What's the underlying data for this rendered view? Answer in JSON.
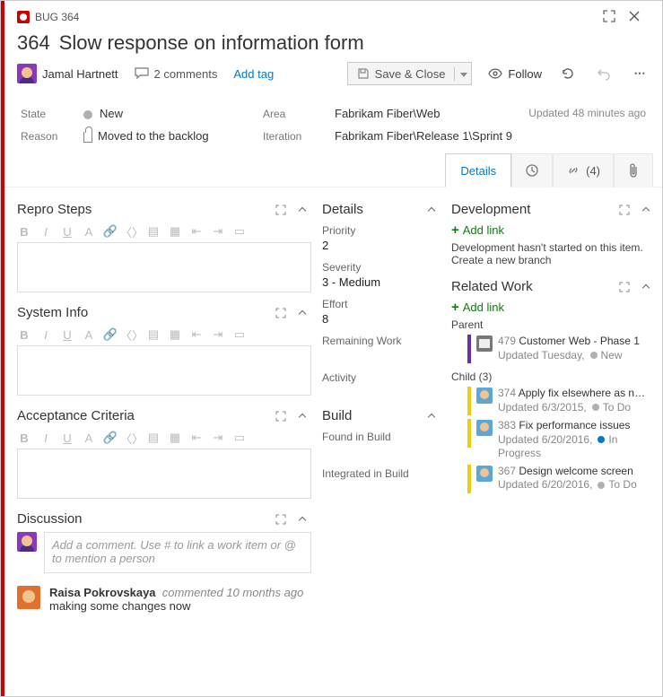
{
  "header": {
    "type_label": "BUG 364",
    "id": "364",
    "title": "Slow response on information form",
    "assignee": "Jamal Hartnett",
    "comments_count": "2 comments",
    "add_tag": "Add tag",
    "save_close": "Save & Close",
    "follow": "Follow",
    "updated": "Updated 48 minutes ago"
  },
  "fields": {
    "state_label": "State",
    "state_value": "New",
    "reason_label": "Reason",
    "reason_value": "Moved to the backlog",
    "area_label": "Area",
    "area_value": "Fabrikam Fiber\\Web",
    "iteration_label": "Iteration",
    "iteration_value": "Fabrikam Fiber\\Release 1\\Sprint 9"
  },
  "tabs": {
    "details": "Details",
    "links_count": "(4)"
  },
  "left": {
    "repro": "Repro Steps",
    "sysinfo": "System Info",
    "acceptance": "Acceptance Criteria",
    "discussion": "Discussion",
    "discussion_placeholder": "Add a comment. Use # to link a work item or @ to mention a person",
    "comment_author": "Raisa Pokrovskaya",
    "comment_action": "commented",
    "comment_when": "10 months ago",
    "comment_body": "making some changes now"
  },
  "mid": {
    "details": "Details",
    "priority_l": "Priority",
    "priority_v": "2",
    "severity_l": "Severity",
    "severity_v": "3 - Medium",
    "effort_l": "Effort",
    "effort_v": "8",
    "remaining_l": "Remaining Work",
    "activity_l": "Activity",
    "build": "Build",
    "found_l": "Found in Build",
    "integrated_l": "Integrated in Build"
  },
  "right": {
    "development": "Development",
    "add_link": "Add link",
    "dev_empty": "Development hasn't started on this item.",
    "create_branch": "Create a new branch",
    "related": "Related Work",
    "parent_l": "Parent",
    "parent_id": "479",
    "parent_title": "Customer Web - Phase 1",
    "parent_meta": "Updated Tuesday,",
    "parent_state": "New",
    "child_l": "Child (3)",
    "c1_id": "374",
    "c1_title": "Apply fix elsewhere as n…",
    "c1_meta": "Updated 6/3/2015,",
    "c1_state": "To Do",
    "c2_id": "383",
    "c2_title": "Fix performance issues",
    "c2_meta": "Updated 6/20/2016,",
    "c2_state": "In Progress",
    "c3_id": "367",
    "c3_title": "Design welcome screen",
    "c3_meta": "Updated 6/20/2016,",
    "c3_state": "To Do"
  }
}
